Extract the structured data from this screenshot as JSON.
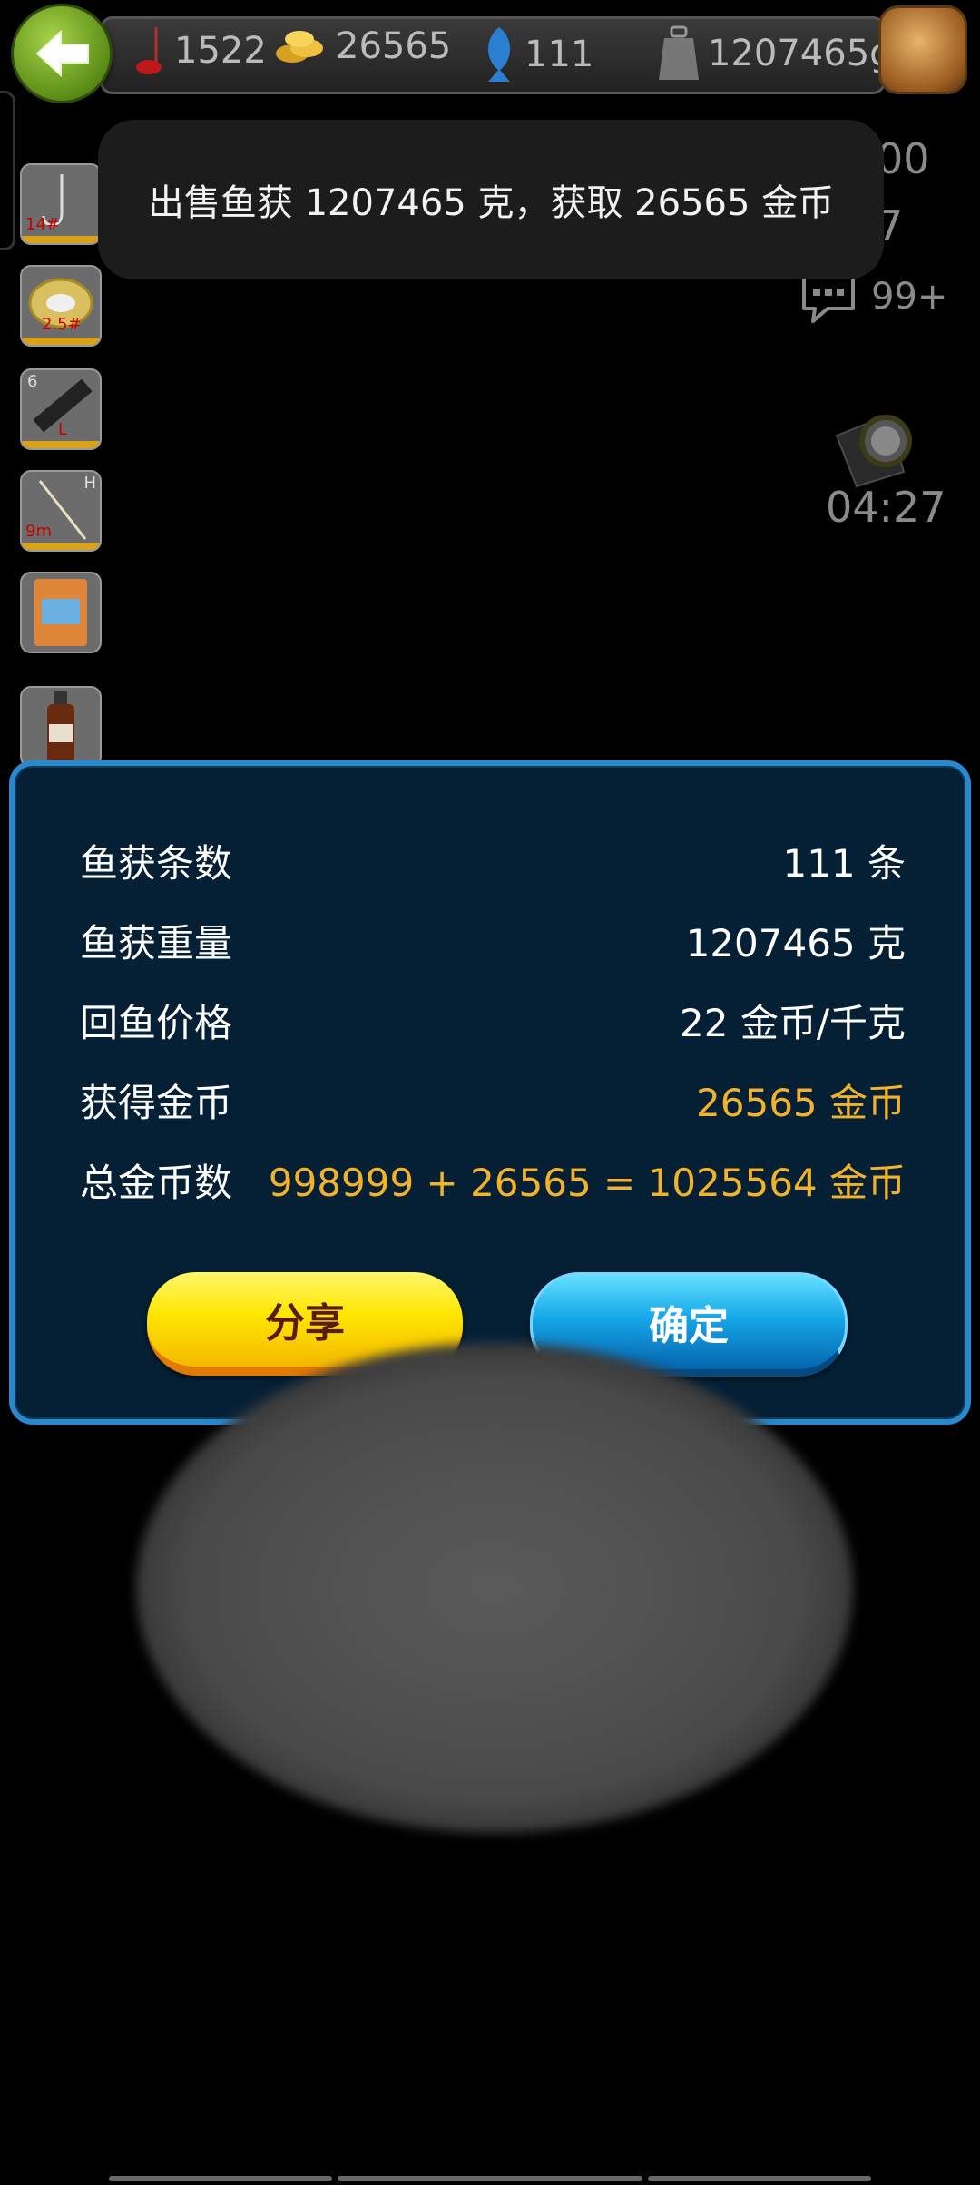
{
  "topbar": {
    "stats": [
      {
        "name": "bait-count",
        "icon": "float-icon",
        "value": "1522"
      },
      {
        "name": "coins",
        "icon": "gold-coins-icon",
        "value": "26565"
      },
      {
        "name": "fish-count",
        "icon": "fish-icon",
        "value": "111"
      },
      {
        "name": "weight",
        "icon": "weight-icon",
        "value": "1207465g"
      }
    ]
  },
  "equipment": [
    {
      "name": "hook",
      "tag": "14#"
    },
    {
      "name": "line",
      "tag": "2.5#"
    },
    {
      "name": "rod",
      "tag_top": "6",
      "tag": "L"
    },
    {
      "name": "float",
      "tag_top": "H",
      "tag": "9m"
    },
    {
      "name": "bait-bag"
    },
    {
      "name": "bait-bottle"
    }
  ],
  "side": {
    "partial_a": "00",
    "partial_b": "7",
    "chat_count": "99+",
    "timer": "04:27"
  },
  "toast": {
    "message": "出售鱼获 1207465 克，获取 26565 金币"
  },
  "dialog": {
    "rows": [
      {
        "label": "鱼获条数",
        "value": "111 条"
      },
      {
        "label": "鱼获重量",
        "value": "1207465 克"
      },
      {
        "label": "回鱼价格",
        "value": "22 金币/千克"
      },
      {
        "label": "获得金币",
        "value": "26565 金币"
      },
      {
        "label": "总金币数",
        "value": "998999 + 26565 = 1025564 金币"
      }
    ],
    "share_label": "分享",
    "ok_label": "确定"
  },
  "colors": {
    "gold_text": "#f2b22a",
    "dialog_border": "#2a88cc",
    "dialog_bg": "#052035"
  }
}
